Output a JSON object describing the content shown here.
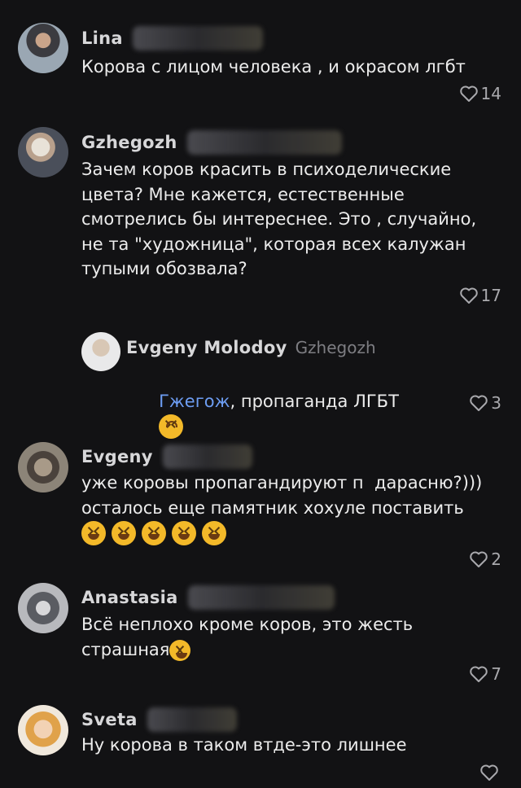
{
  "comments": [
    {
      "author": "Lina",
      "text": "Корова с лицом человека , и окрасом лгбт",
      "likes": "14"
    },
    {
      "author": "Gzhegozh",
      "text": "Зачем коров красить в психоделические\nцвета? Мне кажется, естественные\nсмотрелись бы интереснее. Это , случайно,\nне та \"художница\", которая всех калужан\nтупыми обозвала?",
      "likes": "17"
    },
    {
      "author": "Evgeny Molodoy",
      "reply_to": "Gzhegozh",
      "mention": "Гжегож",
      "text": ", пропаганда ЛГБТ",
      "likes": "3"
    },
    {
      "author": "Evgeny",
      "text": "уже коровы пропагандируют п  дарасню?)))\nосталось еще памятник хохуле поставить",
      "likes": "2"
    },
    {
      "author": "Anastasia",
      "text": "Всё неплохо кроме коров, это жесть\nстрашная",
      "likes": "7"
    },
    {
      "author": "Sveta",
      "text": "Ну корова в таком втде-это лишнее",
      "likes": ""
    }
  ],
  "icons": {
    "like": "heart-outline-icon",
    "emoji_laugh": "squinting-laugh-emoji",
    "emoji_upside": "upside-down-face-emoji",
    "emoji_rofl": "rolling-laughing-emoji"
  },
  "colors": {
    "background": "#121214",
    "mention": "#6d9df2",
    "muted": "#a9a9ad"
  }
}
